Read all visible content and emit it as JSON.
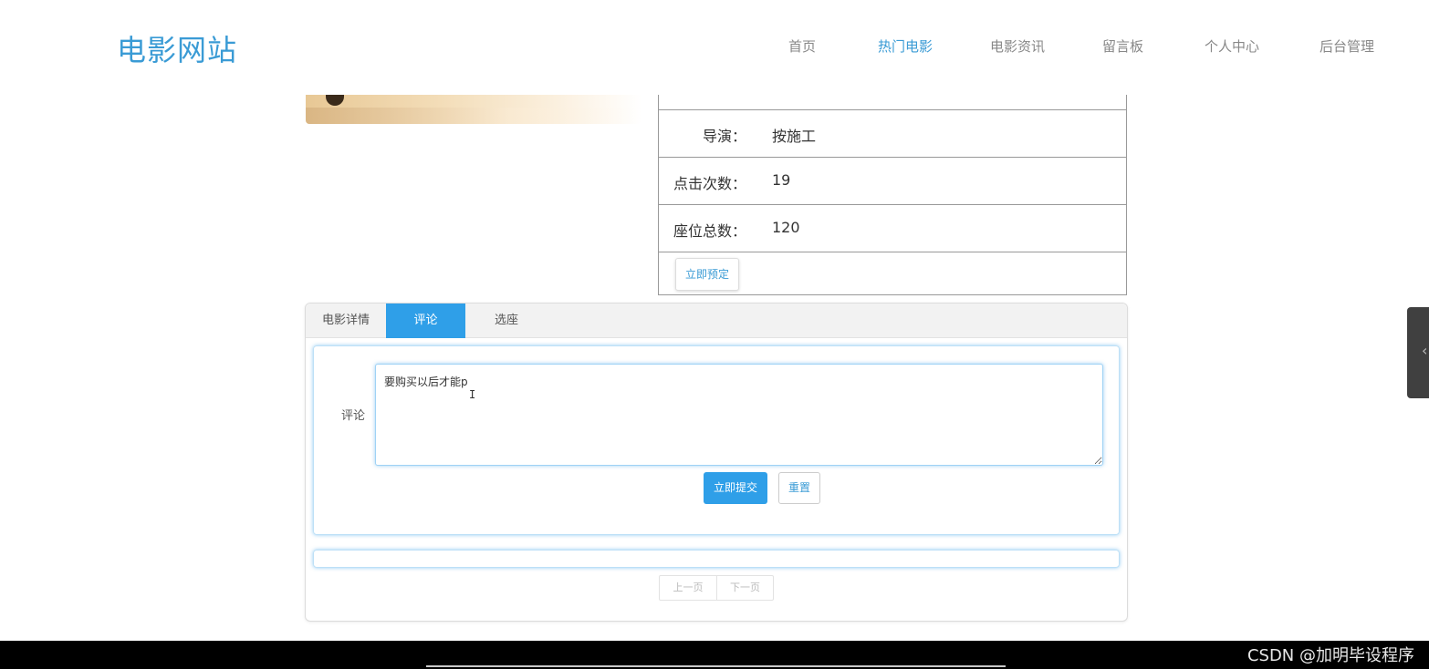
{
  "header": {
    "logo": "电影网站",
    "nav": [
      "首页",
      "热门电影",
      "电影资讯",
      "留言板",
      "个人中心",
      "后台管理"
    ],
    "active_nav": "热门电影"
  },
  "info": {
    "rows": [
      {
        "label": "导演：",
        "value": "按施工"
      },
      {
        "label": "点击次数：",
        "value": "19"
      },
      {
        "label": "座位总数：",
        "value": "120"
      }
    ],
    "book_button": "立即预定"
  },
  "tabs": [
    "电影详情",
    "评论",
    "选座"
  ],
  "active_tab": "评论",
  "comment_form": {
    "label": "评论",
    "value": "要购买以后才能p",
    "submit": "立即提交",
    "reset": "重置"
  },
  "pager": {
    "prev": "上一页",
    "next": "下一页"
  },
  "watermark": "CSDN @加明毕设程序",
  "colors": {
    "accent": "#2f9fe8",
    "logo": "#3a9bd5"
  }
}
